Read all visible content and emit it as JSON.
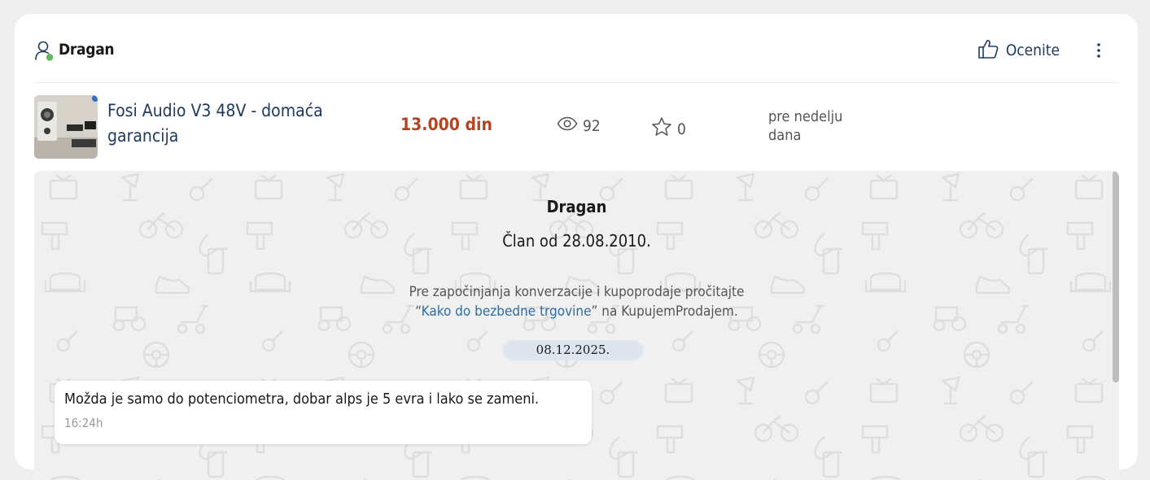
{
  "header": {
    "user_name": "Dragan",
    "rate_label": "Ocenite"
  },
  "ad": {
    "title": "Fosi Audio V3 48V - domaća garancija",
    "price": "13.000 din",
    "views": "92",
    "favorites": "0",
    "posted": "pre nedelju dana"
  },
  "chat": {
    "name": "Dragan",
    "member_since": "Član od 28.08.2010.",
    "info_before": "Pre započinjanja konverzacije i kupoprodaje pročitajte",
    "info_quote_open": "“",
    "info_link": "Kako do bezbedne trgovine",
    "info_after": "” na KupujemProdajem.",
    "date": "08.12.2025.",
    "messages": [
      {
        "text": "Možda je samo do potenciometra, dobar alps je 5 evra i lako se zameni.",
        "time": "16:24h"
      }
    ]
  },
  "colors": {
    "accent": "#1f3a60",
    "price": "#b8441f",
    "link": "#2e6da4",
    "online": "#5cb85c",
    "chat_bg": "#f0f0f0",
    "date_pill": "#dfe5ee"
  },
  "icons": [
    "user-icon",
    "thumbs-up-icon",
    "more-vertical-icon",
    "eye-icon",
    "star-icon"
  ]
}
